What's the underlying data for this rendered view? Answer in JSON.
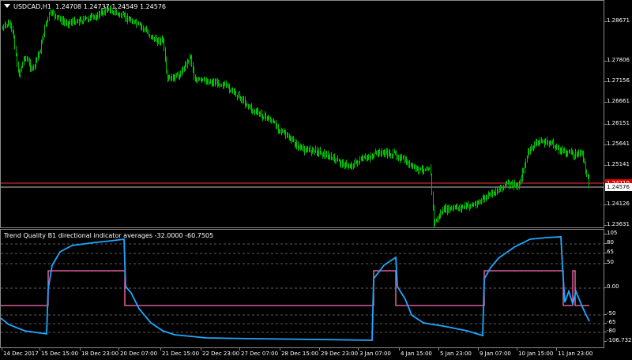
{
  "main_chart": {
    "symbol_label": "USDCAD,H1",
    "ohlc": "1.24708 1.24737 1.24549 1.24576",
    "price_labels": [
      "1.28671",
      "1.27806",
      "1.27156",
      "1.26661",
      "1.26151",
      "1.25641",
      "1.25141",
      "1.24576",
      "1.24126",
      "1.23631"
    ],
    "current_price": "1.24576",
    "bid_tag": "1.24710",
    "candle_color": "#00c000",
    "current_line_color": "#c0c0c0",
    "red_line_color": "#ff3030"
  },
  "indicator": {
    "title": "Trend Quality B1 directional indicator averages -32.0000 -60.7505",
    "levels": [
      "105",
      "80",
      "65",
      "50",
      "0.00",
      "-50",
      "-65",
      "-80",
      "-106.7326"
    ],
    "series": [
      {
        "name": "pink",
        "color": "#ff6eb4"
      },
      {
        "name": "blue",
        "color": "#1ea8ff"
      }
    ]
  },
  "time_axis": {
    "labels": [
      "14 Dec 2017",
      "15 Dec 15:00",
      "18 Dec 23:00",
      "20 Dec 07:00",
      "21 Dec 15:00",
      "22 Dec 23:00",
      "27 Dec 07:00",
      "28 Dec 15:00",
      "29 Dec 23:00",
      "3 Jan 07:00",
      "4 Jan 15:00",
      "5 Jan 23:00",
      "9 Jan 07:00",
      "10 Jan 15:00",
      "11 Jan 23:00"
    ]
  }
}
